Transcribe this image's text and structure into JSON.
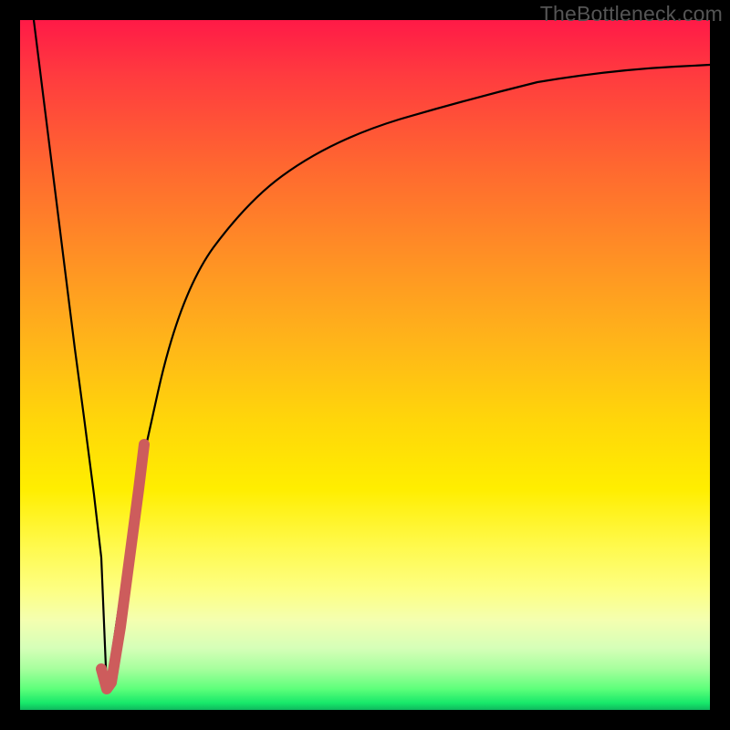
{
  "watermark": {
    "text": "TheBottleneck.com"
  },
  "colors": {
    "background": "#000000",
    "curve": "#000000",
    "highlight": "#cd5c5c",
    "gradient_stops": [
      "#ff1a47",
      "#ff3b3f",
      "#ff6a2f",
      "#ff8f25",
      "#ffb31a",
      "#ffd60a",
      "#ffee00",
      "#fff94a",
      "#fdff82",
      "#f4ffb0",
      "#d6ffb8",
      "#a8ff9e",
      "#5cff7a",
      "#17e86a",
      "#0fb85e"
    ]
  },
  "chart_data": {
    "type": "line",
    "title": "",
    "xlabel": "",
    "ylabel": "",
    "xlim": [
      0,
      100
    ],
    "ylim": [
      0,
      100
    ],
    "note": "x is horizontal position (% of plot width, 0=left); y is height (% of plot height, 0=bottom). Values estimated from pixels.",
    "series": [
      {
        "name": "left-branch",
        "description": "Steep descending line from top-left down to the valley near the bottom.",
        "x": [
          2.0,
          4.0,
          6.0,
          8.0,
          9.3,
          10.7,
          11.8,
          12.6
        ],
        "y": [
          100.0,
          84.1,
          68.2,
          52.4,
          42.5,
          31.2,
          22.1,
          3.0
        ]
      },
      {
        "name": "right-branch",
        "description": "Rising curve from the valley that asymptotically flattens toward the upper right.",
        "x": [
          12.6,
          14.0,
          16.0,
          18.0,
          20.0,
          24.0,
          28.0,
          32.0,
          38.0,
          45.0,
          55.0,
          65.0,
          75.0,
          85.0,
          95.0,
          100.0
        ],
        "y": [
          3.0,
          13.0,
          26.0,
          37.0,
          46.0,
          58.5,
          67.0,
          73.0,
          79.0,
          83.5,
          87.5,
          90.0,
          91.5,
          92.5,
          93.2,
          93.5
        ]
      },
      {
        "name": "highlight-segment",
        "description": "Thick reddish stroke tracing the bottom of the valley and the initial rise.",
        "x": [
          11.8,
          12.6,
          13.2,
          14.5,
          16.0,
          17.2,
          18.0
        ],
        "y": [
          6.0,
          3.0,
          4.0,
          12.0,
          23.0,
          32.0,
          38.5
        ]
      }
    ]
  }
}
